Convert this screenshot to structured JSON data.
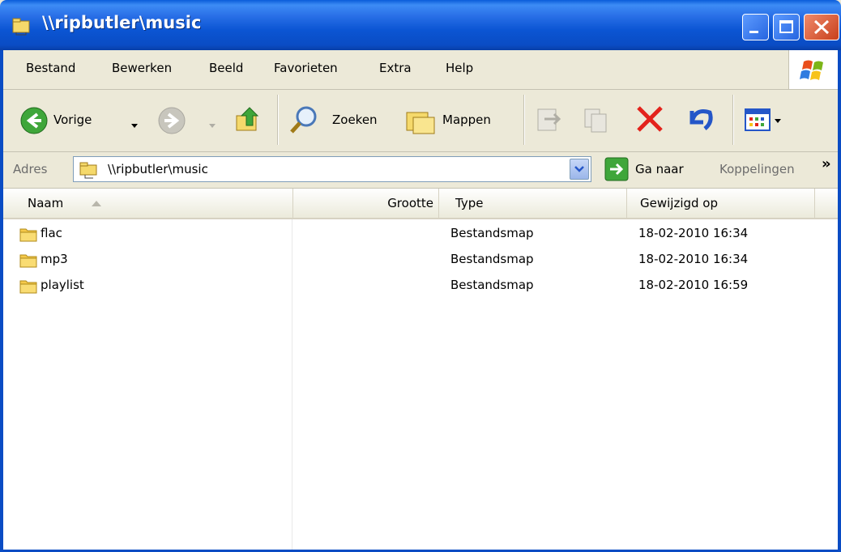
{
  "window": {
    "title": "\\\\ripbutler\\music"
  },
  "menu": [
    {
      "label": "Bestand"
    },
    {
      "label": "Bewerken"
    },
    {
      "label": "Beeld"
    },
    {
      "label": "Favorieten"
    },
    {
      "label": "Extra"
    },
    {
      "label": "Help"
    }
  ],
  "toolbar": {
    "back_label": "Vorige",
    "search_label": "Zoeken",
    "folders_label": "Mappen"
  },
  "address": {
    "label": "Adres",
    "value": "\\\\ripbutler\\music",
    "go_label": "Ga naar",
    "links_label": "Koppelingen",
    "chevron": "»"
  },
  "list": {
    "columns": [
      {
        "label": "Naam"
      },
      {
        "label": "Grootte"
      },
      {
        "label": "Type"
      },
      {
        "label": "Gewijzigd op"
      }
    ],
    "rows": [
      {
        "name": "flac",
        "type": "Bestandsmap",
        "modified": "18-02-2010 16:34"
      },
      {
        "name": "mp3",
        "type": "Bestandsmap",
        "modified": "18-02-2010 16:34"
      },
      {
        "name": "playlist",
        "type": "Bestandsmap",
        "modified": "18-02-2010 16:59"
      }
    ]
  },
  "colors": {
    "titlebar": "#0a4cc4",
    "window_bg": "#ece9d8",
    "close": "#c8401c",
    "folder": "#f5c94a"
  }
}
